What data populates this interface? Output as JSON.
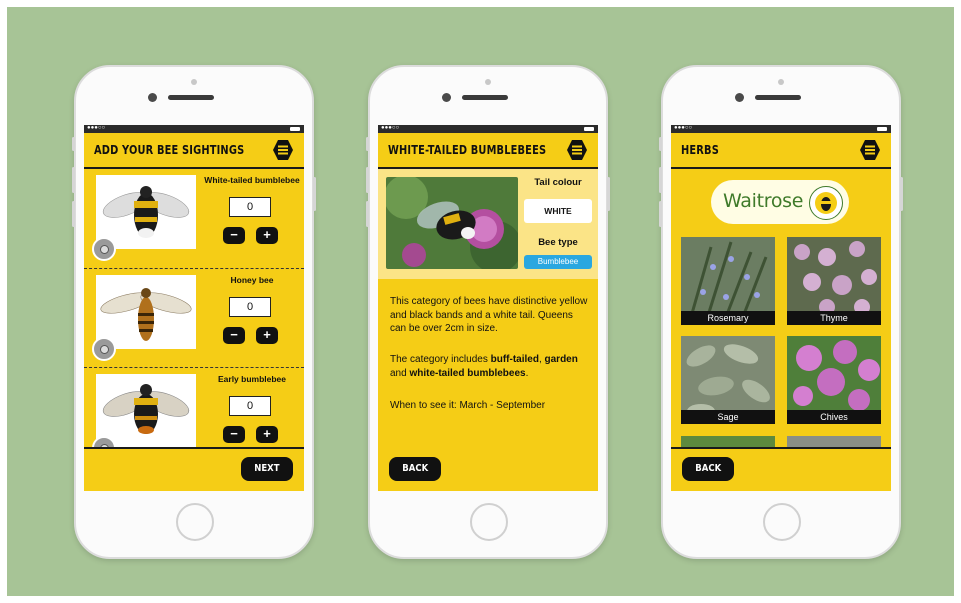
{
  "colors": {
    "background": "#a7c496",
    "accent_yellow": "#f5cd16",
    "dark": "#111111",
    "blue_badge": "#2aa7e0"
  },
  "screen1": {
    "title": "ADD YOUR BEE SIGHTINGS",
    "menu_icon": "menu-hexagon-icon",
    "items": [
      {
        "name": "White-tailed bumblebee",
        "count": "0",
        "minus": "−",
        "plus": "+"
      },
      {
        "name": "Honey bee",
        "count": "0",
        "minus": "−",
        "plus": "+"
      },
      {
        "name": "Early bumblebee",
        "count": "0",
        "minus": "−",
        "plus": "+"
      }
    ],
    "next_label": "NEXT"
  },
  "screen2": {
    "title": "WHITE-TAILED BUMBLEBEES",
    "tail_colour_label": "Tail colour",
    "tail_colour_value": "WHITE",
    "bee_type_label": "Bee type",
    "bee_type_value": "Bumblebee",
    "para1": "This category of bees have distinctive yellow and black bands and a white tail. Queens can be over 2cm in size.",
    "para2_prefix": "The category includes ",
    "para2_b1": "buff-tailed",
    "para2_sep1": ", ",
    "para2_b2": "garden",
    "para2_mid": " and ",
    "para2_b3": "white-tailed bumblebees",
    "para2_end": ".",
    "when": "When to see it: March - September",
    "back_label": "BACK"
  },
  "screen3": {
    "title": "HERBS",
    "logo": "Waitrose",
    "herbs": [
      "Rosemary",
      "Thyme",
      "Sage",
      "Chives"
    ],
    "back_label": "BACK"
  }
}
